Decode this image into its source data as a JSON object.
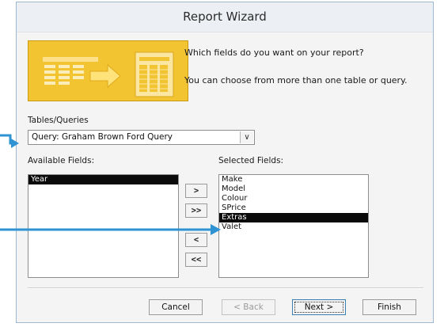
{
  "window": {
    "title": "Report Wizard"
  },
  "intro": {
    "prompt": "Which fields do you want on your report?",
    "hint": "You can choose from more than one table or query."
  },
  "tables_queries": {
    "label": "Tables/Queries",
    "selected": "Query: Graham Brown Ford Query",
    "dropdown_icon": "chevron-down-icon"
  },
  "available_fields": {
    "label": "Available Fields:",
    "items": [
      "Year"
    ],
    "selected_index": 0
  },
  "selected_fields": {
    "label": "Selected Fields:",
    "items": [
      "Make",
      "Model",
      "Colour",
      "SPrice",
      "Extras",
      "Valet"
    ],
    "selected_index": 4
  },
  "move_buttons": {
    "add_one": ">",
    "add_all": ">>",
    "remove_one": "<",
    "remove_all": "<<"
  },
  "footer": {
    "cancel": "Cancel",
    "back": "< Back",
    "next": "Next >",
    "finish": "Finish"
  },
  "colors": {
    "graphic_yellow": "#f2c431",
    "arrow_blue": "#2f93d3",
    "selection": "#0a0a0a"
  }
}
